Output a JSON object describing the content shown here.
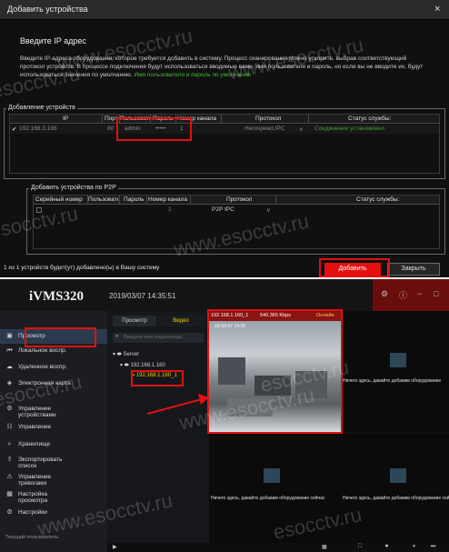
{
  "dialog": {
    "title": "Добавить устройства",
    "close_symbol": "×",
    "heading": "Введите IP адрес",
    "description": "Введите IP-адреса оборудования, которое требуется добавить в систему. Процесс сканирования можно ускорить, выбрав соответствующий протокол устройств. В процессе подключения будут использоваться вводимые вами, имя пользователя и пароль, но если вы не вводите их, будут использоваться значения по умолчанию.",
    "description_link": "Имя пользователя и пароль по умолчанию",
    "ip_group": {
      "label": "Добавление устройств",
      "columns": [
        "IP",
        "Порт",
        "Пользователь",
        "Пароль",
        "Номер канала",
        "Протокол",
        "Статус службы:"
      ],
      "row": {
        "checked": "✔",
        "ip": "192.168.3.186",
        "port": "80",
        "user": "admin",
        "password": "•••••",
        "channel": "1",
        "protocol": "Herospeed,IPC",
        "dropdown": "∨",
        "status": "Соединение установлено"
      }
    },
    "p2p_group": {
      "label": "Добавить устройства по P2P",
      "columns": [
        "Серийный номер",
        "Пользователь",
        "Пароль",
        "Номер канала",
        "Протокол",
        "Статус службы:"
      ],
      "row": {
        "channel": "1",
        "protocol": "P2P IPC",
        "dropdown": "∨"
      }
    },
    "summary": "1 из 1 устройств будет(ут) добавлено(ы) в Вашу систему",
    "add_button": "Добавить",
    "close_button": "Закрыть"
  },
  "app": {
    "brand": "iVMS320",
    "datetime": "2019/03/07 14:35:51",
    "top_icons": [
      "⚙",
      "ⓘ",
      "−",
      "□"
    ],
    "nav": [
      {
        "icon": "▣",
        "label": "Просмотр"
      },
      {
        "icon": "⏮",
        "label": "Локальное воспр."
      },
      {
        "icon": "☁",
        "label": "Удаленное воспр."
      },
      {
        "icon": "◈",
        "label": "Электронная карта"
      },
      {
        "icon": "⚙",
        "label": "Управление устройствами"
      },
      {
        "icon": "☷",
        "label": "Управление"
      },
      {
        "icon": "⌕",
        "label": "Хранилище"
      },
      {
        "icon": "⇪",
        "label": "Экспортировать список"
      },
      {
        "icon": "⚠",
        "label": "Управление тревогами"
      },
      {
        "icon": "▦",
        "label": "Настройка просмотра"
      },
      {
        "icon": "⚙",
        "label": "Настройки"
      }
    ],
    "user": "Текущий пользователь",
    "tabs": {
      "preview": "Просмотр",
      "video": "Видео"
    },
    "search_placeholder": "Введите имя видеовхода",
    "tree": {
      "server": "Server",
      "device": "192.168.1.160",
      "channel": "192.168.1.160_1"
    },
    "video": {
      "header_left": "192.168.1.160_1",
      "header_rate": "540.365 Kbps",
      "header_status": "Онлайн",
      "timestamp": "19-03-07 14:35"
    },
    "empty_message_full": "Ничего здесь, давайте добавим оборудование сейчас",
    "empty_message_right": "Ничего здесь, давайте добавим оборудование"
  },
  "watermark": "www.esocctv.ru",
  "watermark_short": "esocctv.ru",
  "colors": {
    "accent_red": "#e01010",
    "status_green": "#3fbf2f",
    "highlight_yellow": "#f0d000"
  }
}
